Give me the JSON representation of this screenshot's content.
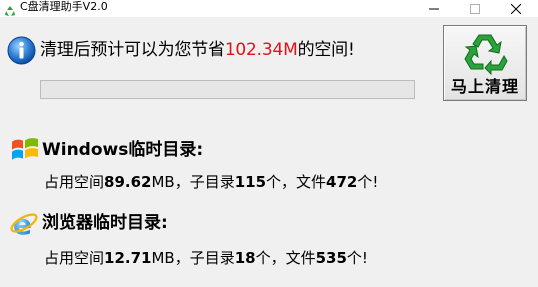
{
  "window": {
    "title": "C盘清理助手V2.0",
    "controls": [
      "minimize",
      "maximize",
      "close"
    ]
  },
  "summary": {
    "icon": "info-icon",
    "prefix": "清理后预计可以为您节省",
    "amount": "102.34M",
    "suffix": "的空间!",
    "amount_color": "#e0121b",
    "progress": 0
  },
  "clean_button": {
    "icon": "recycle-icon",
    "label": "马上清理"
  },
  "windows_temp": {
    "icon": "windows-logo-icon",
    "title": "Windows临时目录:",
    "t1": "占用空间",
    "space": "89.62",
    "t2": "MB，子目录",
    "subdirs": "115",
    "t3": "个，文件",
    "files": "472",
    "t4": "个!"
  },
  "browser_temp": {
    "icon": "internet-explorer-icon",
    "title": "浏览器临时目录:",
    "t1": "占用空间",
    "space": "12.71",
    "t2": "MB，子目录",
    "subdirs": "18",
    "t3": "个，文件",
    "files": "535",
    "t4": "个!"
  },
  "colors": {
    "background": "#f0f0f0",
    "accent_red": "#e0121b",
    "recycle_green": "#2aa43a"
  }
}
